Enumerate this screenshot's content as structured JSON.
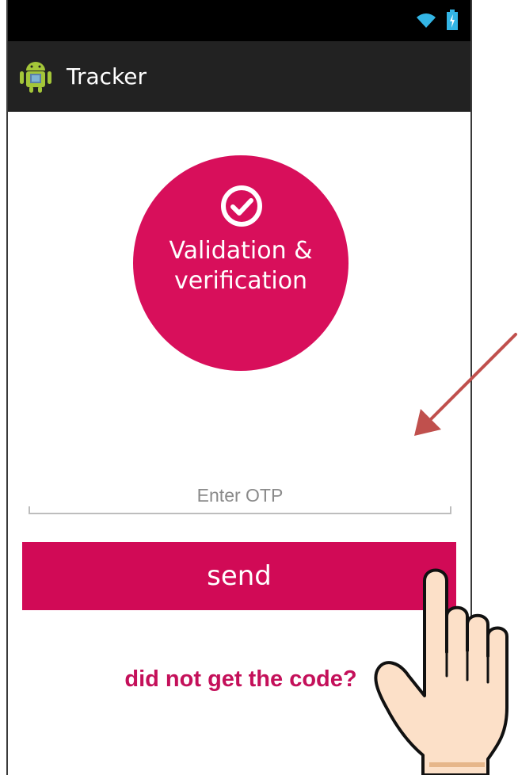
{
  "status_bar": {
    "icons": [
      "wifi-icon",
      "battery-charging-icon"
    ]
  },
  "action_bar": {
    "app_icon": "android-app-icon",
    "title": "Tracker"
  },
  "badge": {
    "icon": "check-circle-icon",
    "line1": "Validation &",
    "line2": "verification",
    "color": "#d80f5b"
  },
  "otp": {
    "placeholder": "Enter OTP",
    "value": ""
  },
  "actions": {
    "send_label": "send",
    "resend_label": "did not get the code?"
  },
  "colors": {
    "accent": "#d10a56",
    "status_bar": "#000000",
    "action_bar": "#222222",
    "annotation_arrow": "#c0504d"
  },
  "overlays": {
    "arrow": "annotation-arrow-icon",
    "hand": "hand-pointer-icon"
  }
}
